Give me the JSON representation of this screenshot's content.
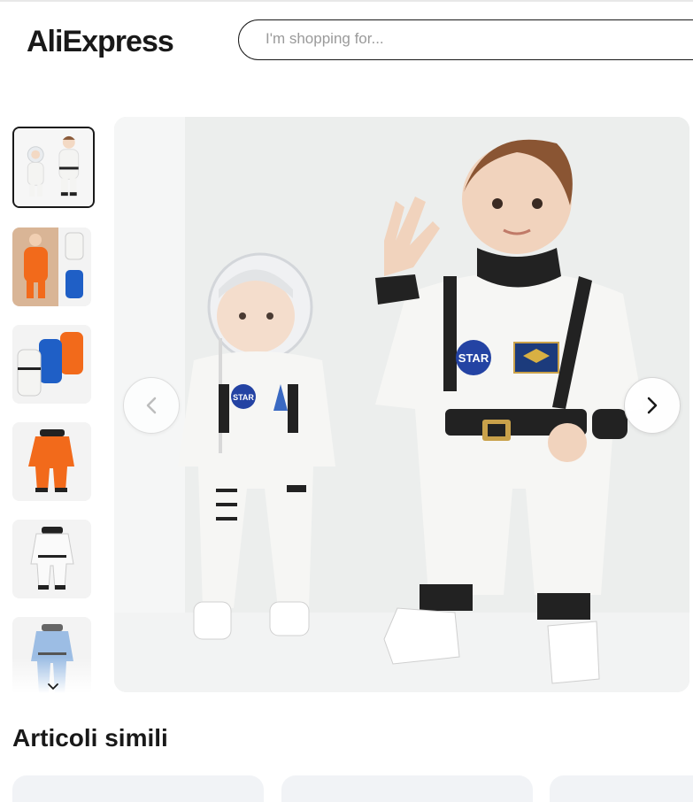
{
  "header": {
    "logo": "AliExpress",
    "search_placeholder": "I'm shopping for..."
  },
  "gallery": {
    "thumbnails": [
      {
        "label": "two toddlers in white astronaut suits",
        "active": true
      },
      {
        "label": "orange and blue astronaut suits",
        "active": false
      },
      {
        "label": "white, blue and orange astronaut suits",
        "active": false
      },
      {
        "label": "orange astronaut suit",
        "active": false
      },
      {
        "label": "white astronaut suit",
        "active": false
      },
      {
        "label": "white and blue astronaut suit",
        "active": false
      }
    ],
    "main_image": "toddlers in white astronaut costumes",
    "patch_text": "STAR"
  },
  "similar": {
    "title": "Articoli simili"
  },
  "colors": {
    "brand_yellow": "#f7b500",
    "text": "#191919",
    "suit_white": "#f4f4f2",
    "suit_orange": "#f26a1b",
    "suit_blue": "#1f5fc6"
  }
}
